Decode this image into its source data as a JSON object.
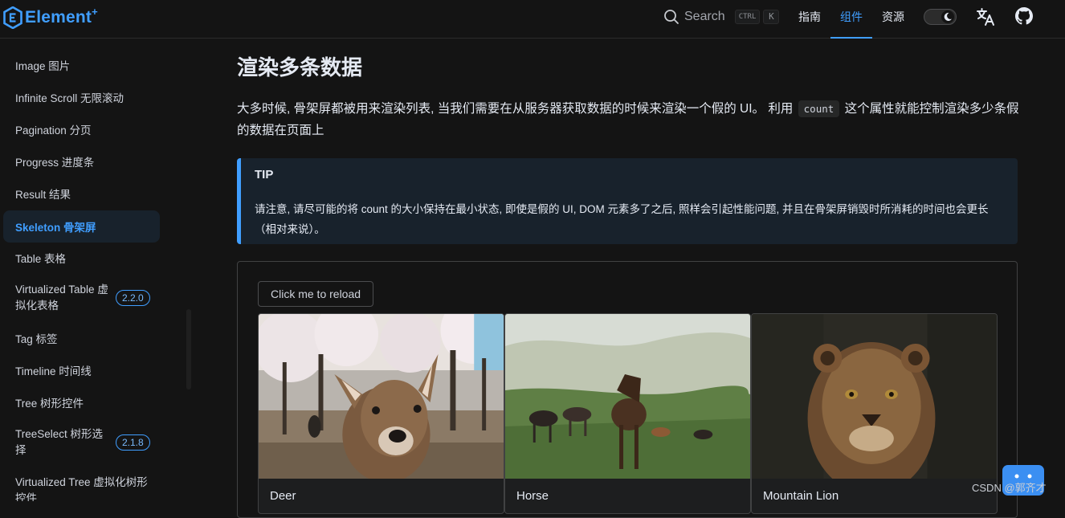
{
  "brand": {
    "name": "Element",
    "superscript": "+"
  },
  "search": {
    "label": "Search",
    "kbd_ctrl": "CTRL",
    "kbd_key": "K"
  },
  "nav": {
    "items": [
      {
        "label": "指南"
      },
      {
        "label": "组件"
      },
      {
        "label": "资源"
      }
    ]
  },
  "sidebar": {
    "items": [
      {
        "label": "Image 图片"
      },
      {
        "label": "Infinite Scroll 无限滚动"
      },
      {
        "label": "Pagination 分页"
      },
      {
        "label": "Progress 进度条"
      },
      {
        "label": "Result 结果"
      },
      {
        "label": "Skeleton 骨架屏"
      },
      {
        "label": "Table 表格"
      },
      {
        "label": "Virtualized Table 虚拟化表格",
        "badge": "2.2.0"
      },
      {
        "label": "Tag 标签"
      },
      {
        "label": "Timeline 时间线"
      },
      {
        "label": "Tree 树形控件"
      },
      {
        "label": "TreeSelect 树形选择",
        "badge": "2.1.8"
      },
      {
        "label": "Virtualized Tree 虚拟化树形控件"
      }
    ]
  },
  "main": {
    "title": "渲染多条数据",
    "paragraph_before": "大多时候, 骨架屏都被用来渲染列表, 当我们需要在从服务器获取数据的时候来渲染一个假的 UI。 利用",
    "paragraph_code": "count",
    "paragraph_after": "这个属性就能控制渲染多少条假的数据在页面上",
    "tip": {
      "title": "TIP",
      "text": "请注意, 请尽可能的将 count 的大小保持在最小状态, 即使是假的 UI, DOM 元素多了之后, 照样会引起性能问题, 并且在骨架屏销毁时所消耗的时间也会更长（相对来说）。"
    },
    "demo": {
      "button_label": "Click me to reload",
      "cards": [
        {
          "name": "Deer"
        },
        {
          "name": "Horse"
        },
        {
          "name": "Mountain Lion"
        }
      ]
    }
  },
  "watermark": "CSDN @郭齐才",
  "colors": {
    "accent": "#409eff",
    "background": "#141414",
    "tip_background": "#18222c"
  },
  "icons": [
    "search-icon",
    "moon-icon",
    "translate-icon",
    "github-icon",
    "chat-bot-icon"
  ]
}
